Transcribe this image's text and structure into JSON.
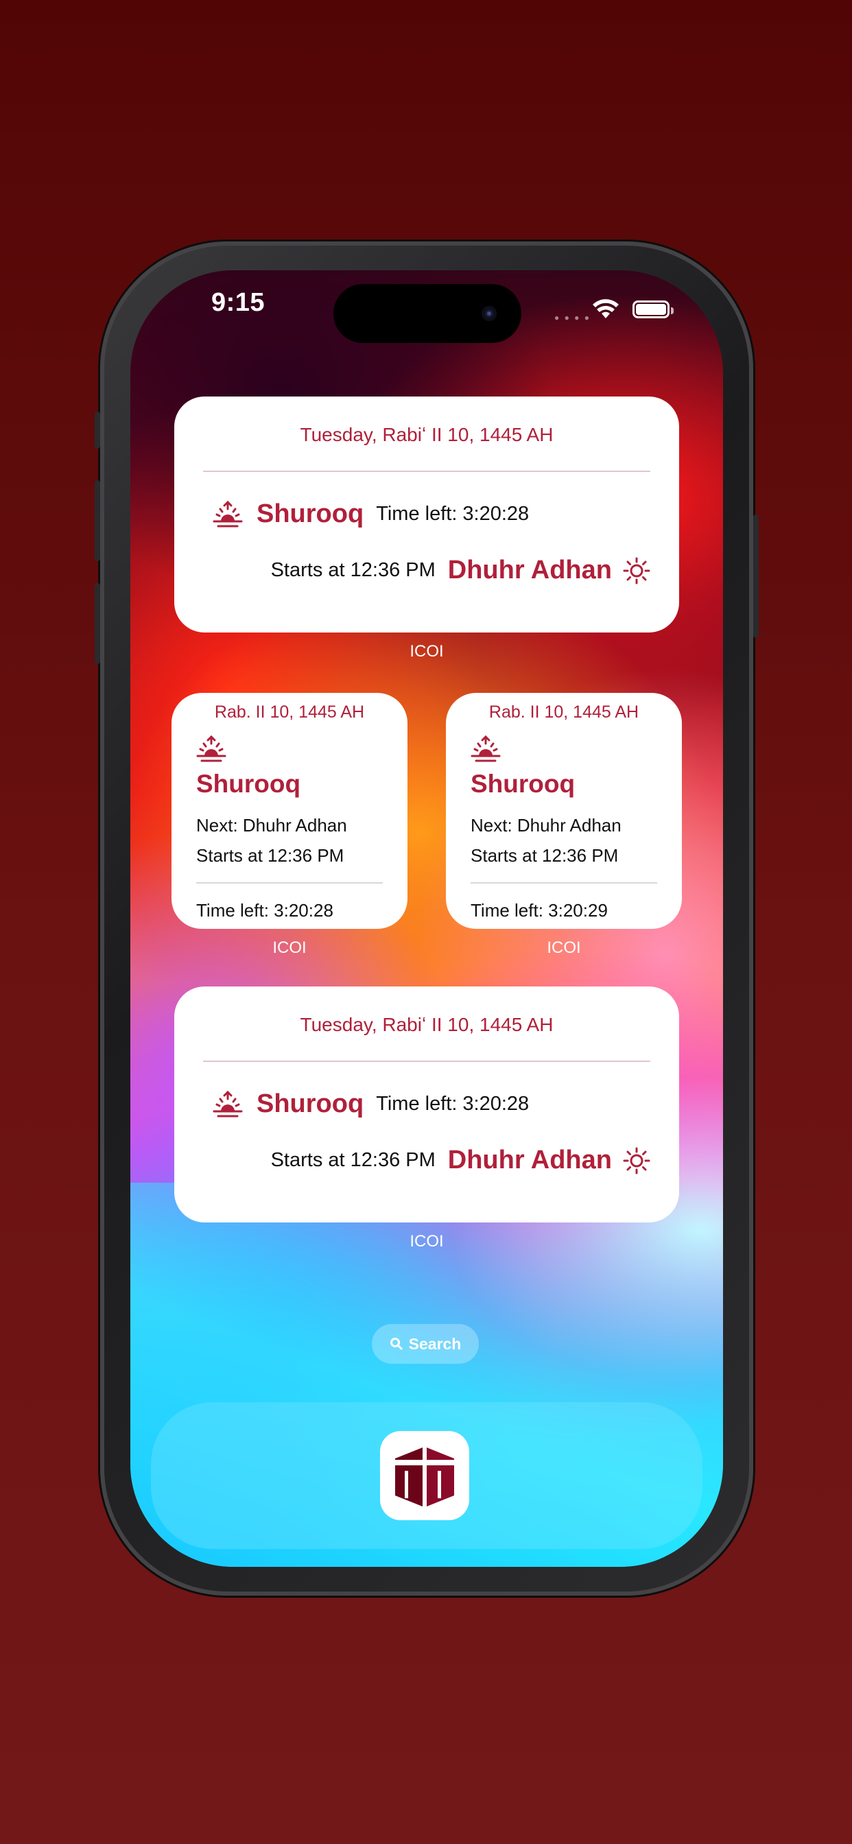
{
  "status_bar": {
    "time": "9:15"
  },
  "widgets": {
    "large_1": {
      "date": "Tuesday, Rabiʻ II 10, 1445 AH",
      "current_prayer": "Shurooq",
      "time_left": "Time left: 3:20:28",
      "starts_at": "Starts at 12:36 PM",
      "next_prayer": "Dhuhr Adhan",
      "label": "ICOI"
    },
    "small_left": {
      "date": "Rab. II 10, 1445 AH",
      "current_prayer": "Shurooq",
      "next": "Next: Dhuhr Adhan",
      "starts_at": "Starts at 12:36 PM",
      "time_left": "Time left: 3:20:28",
      "label": "ICOI"
    },
    "small_right": {
      "date": "Rab. II 10, 1445 AH",
      "current_prayer": "Shurooq",
      "next": "Next: Dhuhr Adhan",
      "starts_at": "Starts at 12:36 PM",
      "time_left": "Time left: 3:20:29",
      "label": "ICOI"
    },
    "large_2": {
      "date": "Tuesday, Rabiʻ II 10, 1445 AH",
      "current_prayer": "Shurooq",
      "time_left": "Time left: 3:20:28",
      "starts_at": "Starts at 12:36 PM",
      "next_prayer": "Dhuhr Adhan",
      "label": "ICOI"
    }
  },
  "search": {
    "label": "Search"
  },
  "dock": {
    "apps": [
      {
        "name": "ICOI",
        "icon": "kaaba-icon"
      }
    ]
  },
  "colors": {
    "accent": "#b0203a",
    "background": "#5c0a0a",
    "icon_bg": "#8b0a2a"
  },
  "icons": {
    "sunrise": "sunrise-icon",
    "sun": "sun-icon",
    "search": "search-icon",
    "wifi": "wifi-icon",
    "battery": "battery-icon"
  }
}
